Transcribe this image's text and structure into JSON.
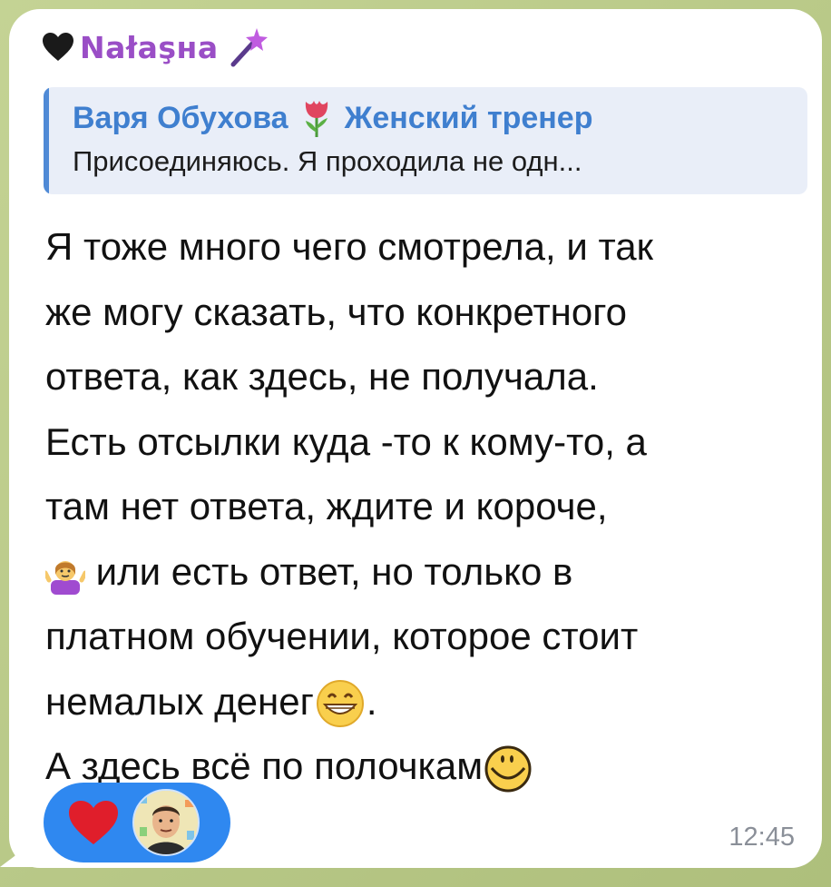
{
  "sender": {
    "name": "Nałaşнa",
    "color": "#9a4ec6"
  },
  "reply": {
    "author": "Варя Обухова",
    "author_suffix": "Женский тренер",
    "text": "Присоединяюсь. Я проходила не одн...",
    "accent": "#3f7fcf"
  },
  "message": {
    "line1": "Я тоже много чего смотрела, и так",
    "line2": "же могу сказать, что конкретного",
    "line3": "ответа, как здесь, не получала.",
    "line4": "Есть отсылки куда -то к кому-то, а",
    "line5": "там нет ответа, ждите и короче,",
    "line6": " или есть ответ, но только в",
    "line7": "платном обучении, которое стоит",
    "line8": "немалых денег",
    "line8_end": ".",
    "line9": "А здесь всё по полочкам"
  },
  "reactions": {
    "background": "#2f88f0",
    "items": [
      "heart-reaction",
      "user-avatar-reaction"
    ]
  },
  "time": "12:45"
}
